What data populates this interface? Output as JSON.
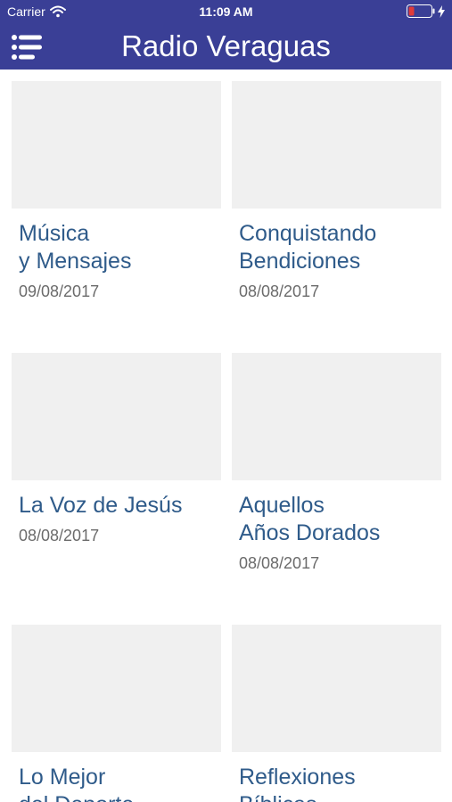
{
  "status_bar": {
    "carrier": "Carrier",
    "time": "11:09 AM",
    "battery_color": "#e03b3b"
  },
  "app_bar": {
    "title": "Radio Veraguas",
    "menu_icon": "menu-icon",
    "background": "#3a3f96"
  },
  "programs": [
    {
      "title": "Música\ny Mensajes",
      "date": "09/08/2017"
    },
    {
      "title": "Conquistando\nBendiciones",
      "date": "08/08/2017"
    },
    {
      "title": "La Voz de Jesús",
      "date": "08/08/2017"
    },
    {
      "title": "Aquellos\nAños Dorados",
      "date": "08/08/2017"
    },
    {
      "title": "Lo Mejor\ndel Deporte",
      "date": ""
    },
    {
      "title": "Reflexiones\nBíblicas",
      "date": ""
    }
  ]
}
